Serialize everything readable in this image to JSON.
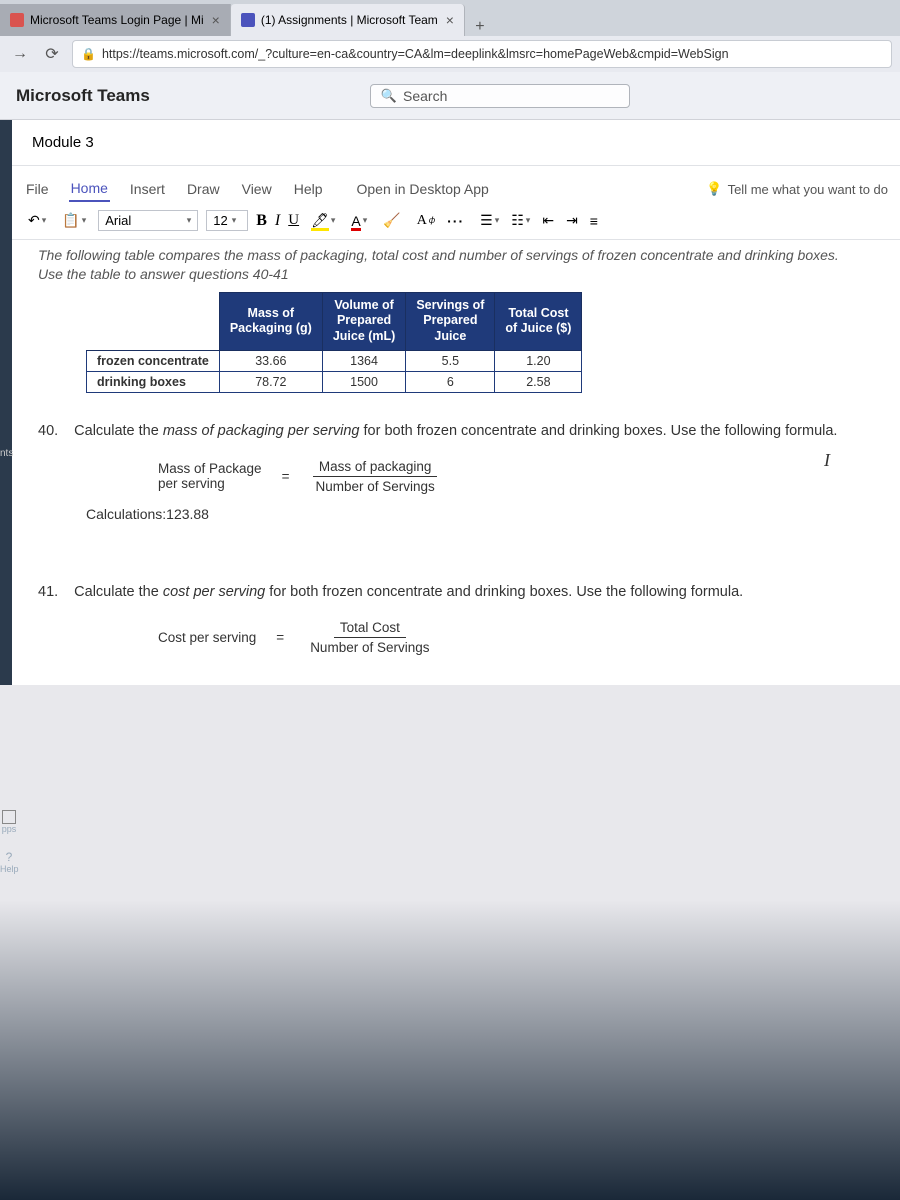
{
  "browser": {
    "tab1": "Microsoft Teams Login Page | Mi",
    "tab2": "(1) Assignments | Microsoft Team",
    "new_tab": "+",
    "url": "https://teams.microsoft.com/_?culture=en-ca&country=CA&lm=deeplink&lmsrc=homePageWeb&cmpid=WebSign"
  },
  "teams": {
    "title": "Microsoft Teams",
    "search_placeholder": "Search"
  },
  "module": {
    "title": "Module 3"
  },
  "ribbon": {
    "file": "File",
    "home": "Home",
    "insert": "Insert",
    "draw": "Draw",
    "view": "View",
    "help": "Help",
    "open_desktop": "Open in Desktop App",
    "tell_me": "Tell me what you want to do",
    "font": "Arial",
    "size": "12"
  },
  "doc": {
    "intro": "The following table compares the mass of packaging, total cost and number of servings of frozen concentrate and drinking boxes. Use the table to answer questions 40-41",
    "table": {
      "headers": [
        "",
        "Mass of Packaging (g)",
        "Volume of Prepared Juice (mL)",
        "Servings of Prepared Juice",
        "Total Cost of Juice ($)"
      ],
      "rows": [
        {
          "label": "frozen concentrate",
          "mass": "33.66",
          "vol": "1364",
          "serv": "5.5",
          "cost": "1.20"
        },
        {
          "label": "drinking boxes",
          "mass": "78.72",
          "vol": "1500",
          "serv": "6",
          "cost": "2.58"
        }
      ]
    },
    "q40": {
      "num": "40.",
      "text": "Calculate the mass of packaging per serving for both frozen concentrate and drinking boxes. Use the following formula.",
      "formula_label": "Mass of Package per serving",
      "frac_top": "Mass of packaging",
      "frac_bot": "Number of Servings",
      "calc": "Calculations:123.88"
    },
    "q41": {
      "num": "41.",
      "text": "Calculate the cost per serving for both frozen concentrate and drinking boxes. Use the following formula.",
      "formula_label": "Cost per serving",
      "frac_top": "Total Cost",
      "frac_bot": "Number of Servings"
    }
  },
  "sidenav": {
    "apps": "pps",
    "help": "Help",
    "nts": "nts"
  }
}
